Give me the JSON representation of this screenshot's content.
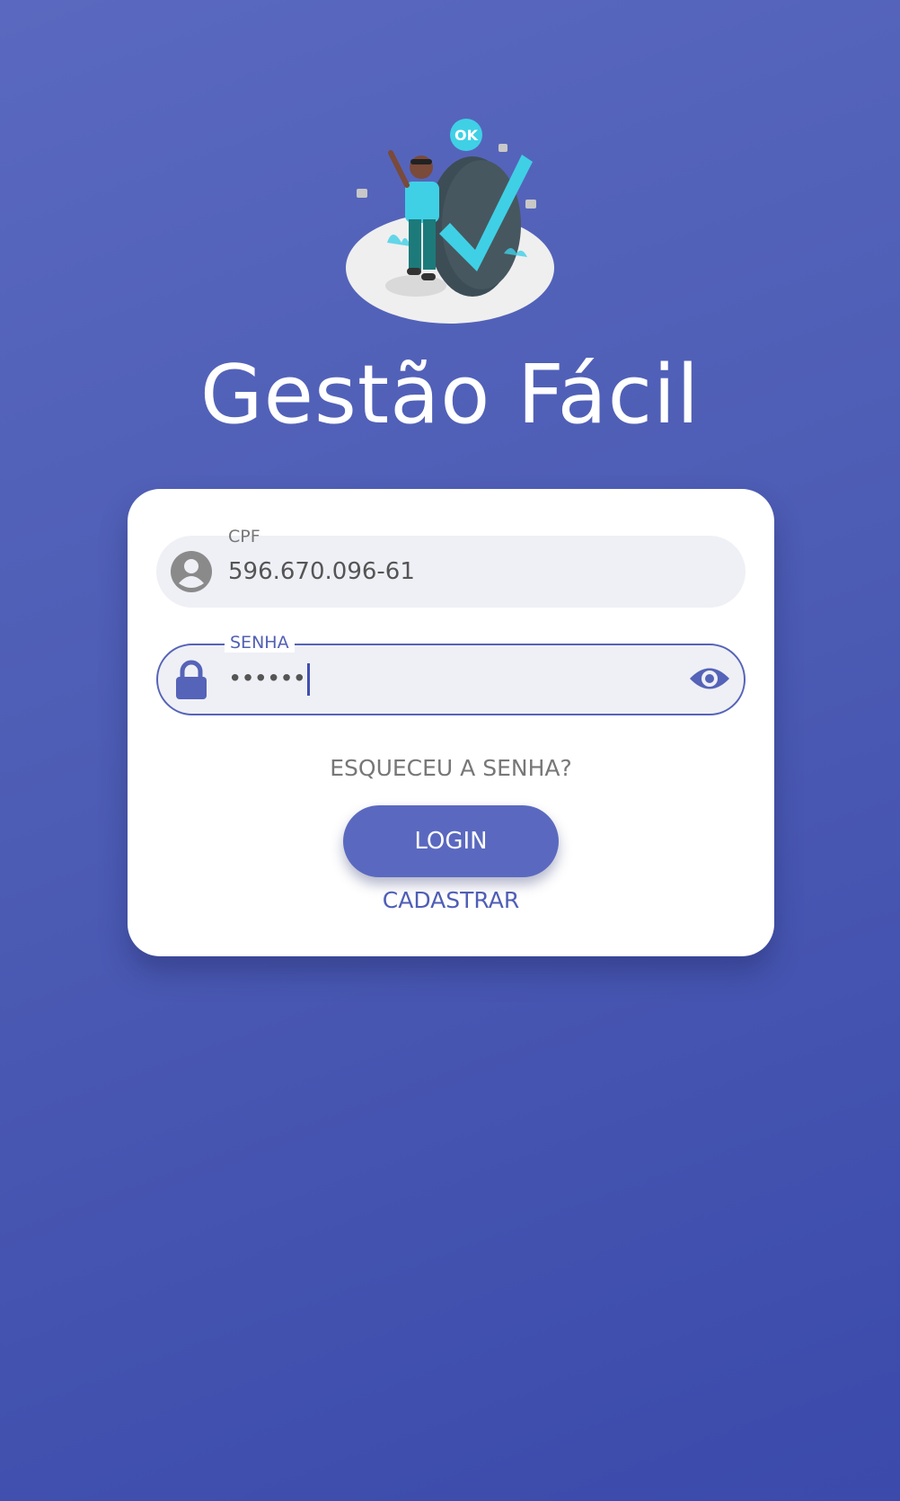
{
  "app": {
    "title": "Gestão Fácil"
  },
  "hero": {
    "illustration": "success-checkmark-illustration",
    "bubble_text": "OK"
  },
  "form": {
    "cpf": {
      "label": "CPF",
      "value": "596.670.096-61",
      "icon": "person-circle-icon"
    },
    "senha": {
      "label": "SENHA",
      "masked_value": "••••••",
      "icon": "lock-icon",
      "toggle_icon": "eye-icon"
    },
    "forgot_label": "ESQUECEU A SENHA?",
    "login_label": "LOGIN",
    "register_label": "CADASTRAR"
  },
  "colors": {
    "accent": "#5a69bf",
    "background_top": "#5a69bf",
    "background_bottom": "#3b4aab",
    "field_bg": "#eff0f5",
    "card_bg": "#ffffff"
  }
}
